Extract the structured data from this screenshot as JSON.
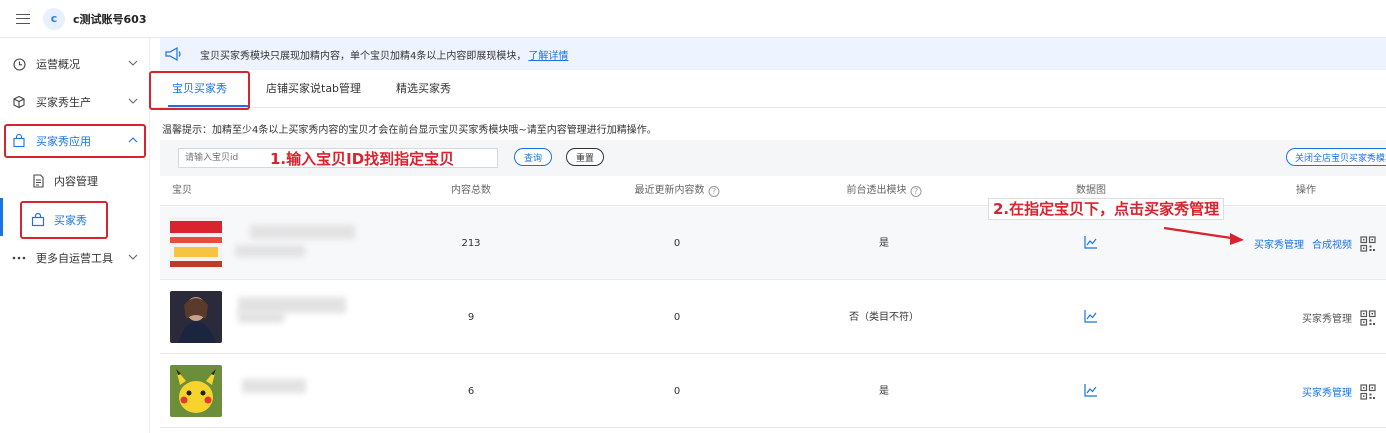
{
  "topbar": {
    "avatar_letter": "c",
    "account_name": "c测试账号603"
  },
  "sidebar": {
    "items": [
      {
        "label": "运营概况",
        "icon": "clock-icon"
      },
      {
        "label": "买家秀生产",
        "icon": "box-icon"
      },
      {
        "label": "买家秀应用",
        "icon": "bag-icon"
      },
      {
        "label": "内容管理",
        "icon": "document-icon"
      },
      {
        "label": "买家秀",
        "icon": "shop-bag-icon"
      },
      {
        "label": "更多自运营工具",
        "icon": "more-icon"
      }
    ]
  },
  "notice": {
    "text": "宝贝买家秀模块只展现加精内容，单个宝贝加精4条以上内容即展现模块，",
    "link": "了解详情"
  },
  "tabs": [
    {
      "label": "宝贝买家秀"
    },
    {
      "label": "店铺买家说tab管理"
    },
    {
      "label": "精选买家秀"
    }
  ],
  "hint": "温馨提示：加精至少4条以上买家秀内容的宝贝才会在前台显示宝贝买家秀模块哦~请至内容管理进行加精操作。",
  "filter": {
    "placeholder": "请输入宝贝id",
    "query_label": "查询",
    "reset_label": "重置",
    "close_all_label": "关闭全店宝贝买家秀模块"
  },
  "table": {
    "headers": [
      "宝贝",
      "内容总数",
      "最近更新内容数",
      "前台透出模块",
      "数据图",
      "操作"
    ],
    "rows": [
      {
        "total": "213",
        "recent": "0",
        "module": "是",
        "ops": [
          "买家秀管理",
          "合成视频"
        ]
      },
      {
        "total": "9",
        "recent": "0",
        "module": "否（类目不符）",
        "ops": [
          "买家秀管理"
        ]
      },
      {
        "total": "6",
        "recent": "0",
        "module": "是",
        "ops": [
          "买家秀管理"
        ]
      }
    ]
  },
  "annotations": {
    "step1": "1.输入宝贝ID找到指定宝贝",
    "step2": "2.在指定宝贝下，点击买家秀管理"
  },
  "colors": {
    "accent": "#1a73e8",
    "annotation_red": "#d9232e"
  }
}
